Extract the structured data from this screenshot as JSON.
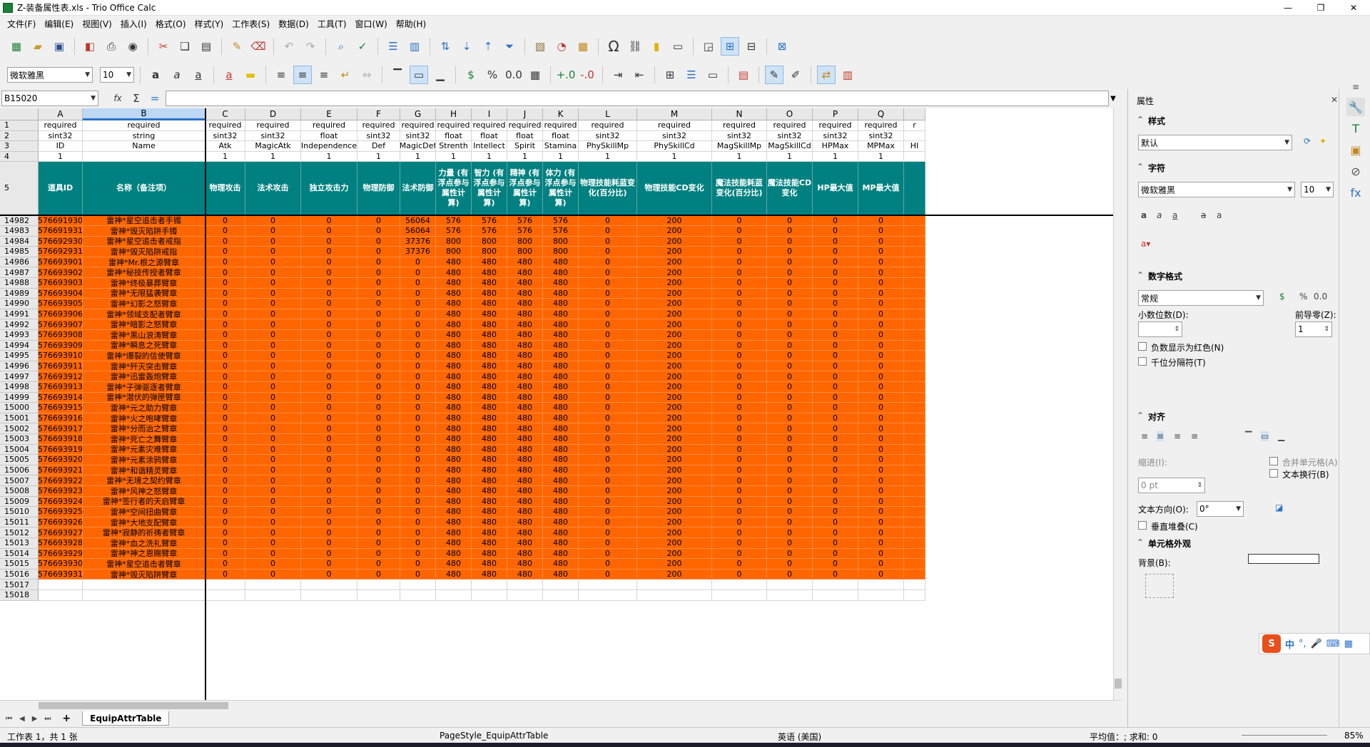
{
  "window": {
    "title": "Z-装备属性表.xls - Trio Office Calc"
  },
  "menu": [
    "文件(F)",
    "编辑(E)",
    "视图(V)",
    "插入(I)",
    "格式(O)",
    "样式(Y)",
    "工作表(S)",
    "数据(D)",
    "工具(T)",
    "窗口(W)",
    "帮助(H)"
  ],
  "format": {
    "font_name": "微软雅黑",
    "font_size": "10"
  },
  "formula": {
    "cell_ref": "B15020",
    "sum_icon": "Σ",
    "equals_icon": "="
  },
  "columns": [
    {
      "letter": "A",
      "req": "required",
      "type": "sint32",
      "field": "ID",
      "ord": "1",
      "name": "道具ID"
    },
    {
      "letter": "B",
      "req": "required",
      "type": "string",
      "field": "Name",
      "ord": "",
      "name": "名称（备注项）"
    },
    {
      "letter": "C",
      "req": "required",
      "type": "sint32",
      "field": "Atk",
      "ord": "1",
      "name": "物理攻击"
    },
    {
      "letter": "D",
      "req": "required",
      "type": "sint32",
      "field": "MagicAtk",
      "ord": "1",
      "name": "法术攻击"
    },
    {
      "letter": "E",
      "req": "required",
      "type": "float",
      "field": "Independence",
      "ord": "1",
      "name": "独立攻击力"
    },
    {
      "letter": "F",
      "req": "required",
      "type": "sint32",
      "field": "Def",
      "ord": "1",
      "name": "物理防御"
    },
    {
      "letter": "G",
      "req": "required",
      "type": "sint32",
      "field": "MagicDef",
      "ord": "1",
      "name": "法术防御"
    },
    {
      "letter": "H",
      "req": "required",
      "type": "float",
      "field": "Strenth",
      "ord": "1",
      "name": "力量 (有浮点参与属性计算)"
    },
    {
      "letter": "I",
      "req": "required",
      "type": "float",
      "field": "Intellect",
      "ord": "1",
      "name": "智力 (有浮点参与属性计算)"
    },
    {
      "letter": "J",
      "req": "required",
      "type": "float",
      "field": "Spirit",
      "ord": "1",
      "name": "精神 (有浮点参与属性计算)"
    },
    {
      "letter": "K",
      "req": "required",
      "type": "float",
      "field": "Stamina",
      "ord": "1",
      "name": "体力 (有浮点参与属性计算)"
    },
    {
      "letter": "L",
      "req": "required",
      "type": "sint32",
      "field": "PhySkillMp",
      "ord": "1",
      "name": "物理技能耗蓝变化(百分比)"
    },
    {
      "letter": "M",
      "req": "required",
      "type": "sint32",
      "field": "PhySkillCd",
      "ord": "1",
      "name": "物理技能CD变化"
    },
    {
      "letter": "N",
      "req": "required",
      "type": "sint32",
      "field": "MagSkillMp",
      "ord": "1",
      "name": "魔法技能耗蓝变化(百分比)"
    },
    {
      "letter": "O",
      "req": "required",
      "type": "sint32",
      "field": "MagSkillCd",
      "ord": "1",
      "name": "魔法技能CD变化"
    },
    {
      "letter": "P",
      "req": "required",
      "type": "sint32",
      "field": "HPMax",
      "ord": "1",
      "name": "HP最大值"
    },
    {
      "letter": "Q",
      "req": "required",
      "type": "sint32",
      "field": "MPMax",
      "ord": "1",
      "name": "MP最大值"
    },
    {
      "letter": "",
      "req": "r",
      "type": "",
      "field": "HI",
      "ord": "",
      "name": ""
    }
  ],
  "header_row_labels": [
    "1",
    "2",
    "3",
    "4",
    "5"
  ],
  "rows": [
    [
      "14982",
      "576691930",
      "雷神*星空追击者手镯",
      "0",
      "0",
      "0",
      "0",
      "56064",
      "576",
      "576",
      "576",
      "576",
      "0",
      "200",
      "0",
      "0",
      "0",
      "0"
    ],
    [
      "14983",
      "576691931",
      "雷神*毁灭陷阱手镯",
      "0",
      "0",
      "0",
      "0",
      "56064",
      "576",
      "576",
      "576",
      "576",
      "0",
      "200",
      "0",
      "0",
      "0",
      "0"
    ],
    [
      "14984",
      "576692930",
      "雷神*星空追击者戒指",
      "0",
      "0",
      "0",
      "0",
      "37376",
      "800",
      "800",
      "800",
      "800",
      "0",
      "200",
      "0",
      "0",
      "0",
      "0"
    ],
    [
      "14985",
      "576692931",
      "雷神*毁灭陷阱戒指",
      "0",
      "0",
      "0",
      "0",
      "37376",
      "800",
      "800",
      "800",
      "800",
      "0",
      "200",
      "0",
      "0",
      "0",
      "0"
    ],
    [
      "14986",
      "576693901",
      "雷神*Mr.根之源臂章",
      "0",
      "0",
      "0",
      "0",
      "0",
      "480",
      "480",
      "480",
      "480",
      "0",
      "200",
      "0",
      "0",
      "0",
      "0"
    ],
    [
      "14987",
      "576693902",
      "雷神*秘技传授者臂章",
      "0",
      "0",
      "0",
      "0",
      "0",
      "480",
      "480",
      "480",
      "480",
      "0",
      "200",
      "0",
      "0",
      "0",
      "0"
    ],
    [
      "14988",
      "576693903",
      "雷神*终极暴葬臂章",
      "0",
      "0",
      "0",
      "0",
      "0",
      "480",
      "480",
      "480",
      "480",
      "0",
      "200",
      "0",
      "0",
      "0",
      "0"
    ],
    [
      "14989",
      "576693904",
      "雷神*无限猛袭臂章",
      "0",
      "0",
      "0",
      "0",
      "0",
      "480",
      "480",
      "480",
      "480",
      "0",
      "200",
      "0",
      "0",
      "0",
      "0"
    ],
    [
      "14990",
      "576693905",
      "雷神*幻影之怒臂章",
      "0",
      "0",
      "0",
      "0",
      "0",
      "480",
      "480",
      "480",
      "480",
      "0",
      "200",
      "0",
      "0",
      "0",
      "0"
    ],
    [
      "14991",
      "576693906",
      "雷神*领域支配者臂章",
      "0",
      "0",
      "0",
      "0",
      "0",
      "480",
      "480",
      "480",
      "480",
      "0",
      "200",
      "0",
      "0",
      "0",
      "0"
    ],
    [
      "14992",
      "576693907",
      "雷神*暗影之怒臂章",
      "0",
      "0",
      "0",
      "0",
      "0",
      "480",
      "480",
      "480",
      "480",
      "0",
      "200",
      "0",
      "0",
      "0",
      "0"
    ],
    [
      "14993",
      "576693908",
      "雷神*黑山浪涛臂章",
      "0",
      "0",
      "0",
      "0",
      "0",
      "480",
      "480",
      "480",
      "480",
      "0",
      "200",
      "0",
      "0",
      "0",
      "0"
    ],
    [
      "14994",
      "576693909",
      "雷神*瞬息之死臂章",
      "0",
      "0",
      "0",
      "0",
      "0",
      "480",
      "480",
      "480",
      "480",
      "0",
      "200",
      "0",
      "0",
      "0",
      "0"
    ],
    [
      "14995",
      "576693910",
      "雷神*爆裂的信使臂章",
      "0",
      "0",
      "0",
      "0",
      "0",
      "480",
      "480",
      "480",
      "480",
      "0",
      "200",
      "0",
      "0",
      "0",
      "0"
    ],
    [
      "14996",
      "576693911",
      "雷神*歼灭突击臂章",
      "0",
      "0",
      "0",
      "0",
      "0",
      "480",
      "480",
      "480",
      "480",
      "0",
      "200",
      "0",
      "0",
      "0",
      "0"
    ],
    [
      "14997",
      "576693912",
      "雷神*迅雷轰炮臂章",
      "0",
      "0",
      "0",
      "0",
      "0",
      "480",
      "480",
      "480",
      "480",
      "0",
      "200",
      "0",
      "0",
      "0",
      "0"
    ],
    [
      "14998",
      "576693913",
      "雷神*子弹驱逐者臂章",
      "0",
      "0",
      "0",
      "0",
      "0",
      "480",
      "480",
      "480",
      "480",
      "0",
      "200",
      "0",
      "0",
      "0",
      "0"
    ],
    [
      "14999",
      "576693914",
      "雷神*潜伏的弹匣臂章",
      "0",
      "0",
      "0",
      "0",
      "0",
      "480",
      "480",
      "480",
      "480",
      "0",
      "200",
      "0",
      "0",
      "0",
      "0"
    ],
    [
      "15000",
      "576693915",
      "雷神*元之助力臂章",
      "0",
      "0",
      "0",
      "0",
      "0",
      "480",
      "480",
      "480",
      "480",
      "0",
      "200",
      "0",
      "0",
      "0",
      "0"
    ],
    [
      "15001",
      "576693916",
      "雷神*火之咆哮臂章",
      "0",
      "0",
      "0",
      "0",
      "0",
      "480",
      "480",
      "480",
      "480",
      "0",
      "200",
      "0",
      "0",
      "0",
      "0"
    ],
    [
      "15002",
      "576693917",
      "雷神*分而治之臂章",
      "0",
      "0",
      "0",
      "0",
      "0",
      "480",
      "480",
      "480",
      "480",
      "0",
      "200",
      "0",
      "0",
      "0",
      "0"
    ],
    [
      "15003",
      "576693918",
      "雷神*死亡之舞臂章",
      "0",
      "0",
      "0",
      "0",
      "0",
      "480",
      "480",
      "480",
      "480",
      "0",
      "200",
      "0",
      "0",
      "0",
      "0"
    ],
    [
      "15004",
      "576693919",
      "雷神*元素灾难臂章",
      "0",
      "0",
      "0",
      "0",
      "0",
      "480",
      "480",
      "480",
      "480",
      "0",
      "200",
      "0",
      "0",
      "0",
      "0"
    ],
    [
      "15005",
      "576693920",
      "雷神*元素涂鸦臂章",
      "0",
      "0",
      "0",
      "0",
      "0",
      "480",
      "480",
      "480",
      "480",
      "0",
      "200",
      "0",
      "0",
      "0",
      "0"
    ],
    [
      "15006",
      "576693921",
      "雷神*和谐精灵臂章",
      "0",
      "0",
      "0",
      "0",
      "0",
      "480",
      "480",
      "480",
      "480",
      "0",
      "200",
      "0",
      "0",
      "0",
      "0"
    ],
    [
      "15007",
      "576693922",
      "雷神*无境之契约臂章",
      "0",
      "0",
      "0",
      "0",
      "0",
      "480",
      "480",
      "480",
      "480",
      "0",
      "200",
      "0",
      "0",
      "0",
      "0"
    ],
    [
      "15008",
      "576693923",
      "雷神*风神之怒臂章",
      "0",
      "0",
      "0",
      "0",
      "0",
      "480",
      "480",
      "480",
      "480",
      "0",
      "200",
      "0",
      "0",
      "0",
      "0"
    ],
    [
      "15009",
      "576693924",
      "雷神*签行者的天启臂章",
      "0",
      "0",
      "0",
      "0",
      "0",
      "480",
      "480",
      "480",
      "480",
      "0",
      "200",
      "0",
      "0",
      "0",
      "0"
    ],
    [
      "15010",
      "576693925",
      "雷神*空间扭曲臂章",
      "0",
      "0",
      "0",
      "0",
      "0",
      "480",
      "480",
      "480",
      "480",
      "0",
      "200",
      "0",
      "0",
      "0",
      "0"
    ],
    [
      "15011",
      "576693926",
      "雷神*大地支配臂章",
      "0",
      "0",
      "0",
      "0",
      "0",
      "480",
      "480",
      "480",
      "480",
      "0",
      "200",
      "0",
      "0",
      "0",
      "0"
    ],
    [
      "15012",
      "576693927",
      "雷神*寂静的祈祷者臂章",
      "0",
      "0",
      "0",
      "0",
      "0",
      "480",
      "480",
      "480",
      "480",
      "0",
      "200",
      "0",
      "0",
      "0",
      "0"
    ],
    [
      "15013",
      "576693928",
      "雷神*血之洗礼臂章",
      "0",
      "0",
      "0",
      "0",
      "0",
      "480",
      "480",
      "480",
      "480",
      "0",
      "200",
      "0",
      "0",
      "0",
      "0"
    ],
    [
      "15014",
      "576693929",
      "雷神*神之恩赐臂章",
      "0",
      "0",
      "0",
      "0",
      "0",
      "480",
      "480",
      "480",
      "480",
      "0",
      "200",
      "0",
      "0",
      "0",
      "0"
    ],
    [
      "15015",
      "576693930",
      "雷神*星空追击者臂章",
      "0",
      "0",
      "0",
      "0",
      "0",
      "480",
      "480",
      "480",
      "480",
      "0",
      "200",
      "0",
      "0",
      "0",
      "0"
    ],
    [
      "15016",
      "576693931",
      "雷神*毁灭陷阱臂章",
      "0",
      "0",
      "0",
      "0",
      "0",
      "480",
      "480",
      "480",
      "480",
      "0",
      "200",
      "0",
      "0",
      "0",
      "0"
    ]
  ],
  "empty_rows": [
    "15017",
    "15018"
  ],
  "sheet_tabs": [
    "EquipAttrTable"
  ],
  "sheet_add": "+",
  "status": {
    "sheet_pos": "工作表 1，共 1 张",
    "page_style": "PageStyle_EquipAttrTable",
    "language": "英语 (美国)",
    "summary": "平均值：; 求和: 0",
    "zoom": "85%"
  },
  "sidebar": {
    "title": "属性",
    "close": "✕",
    "styles_title": "样式",
    "style_value": "默认",
    "char_title": "字符",
    "char_font": "微软雅黑",
    "char_size": "10",
    "numfmt_title": "数字格式",
    "numfmt_value": "常规",
    "decimals_label": "小数位数(D):",
    "leading_label": "前导零(Z):",
    "leading_value": "1",
    "neg_red": "负数显示为红色(N)",
    "thousands": "千位分隔符(T)",
    "align_title": "对齐",
    "merge": "合并单元格(A)",
    "indent_label": "缩进(I):",
    "indent_value": "0 pt",
    "wrap": "文本换行(B)",
    "textdir_label": "文本方向(O):",
    "textdir_value": "0°",
    "vstack": "垂直堆叠(C)",
    "appearance_title": "单元格外观",
    "background_label": "背景(B):"
  },
  "ime": {
    "label": "中"
  },
  "colors": {
    "header_teal": "#008080",
    "row_orange": "#ff6600",
    "active_col": "#bcd8f5"
  }
}
